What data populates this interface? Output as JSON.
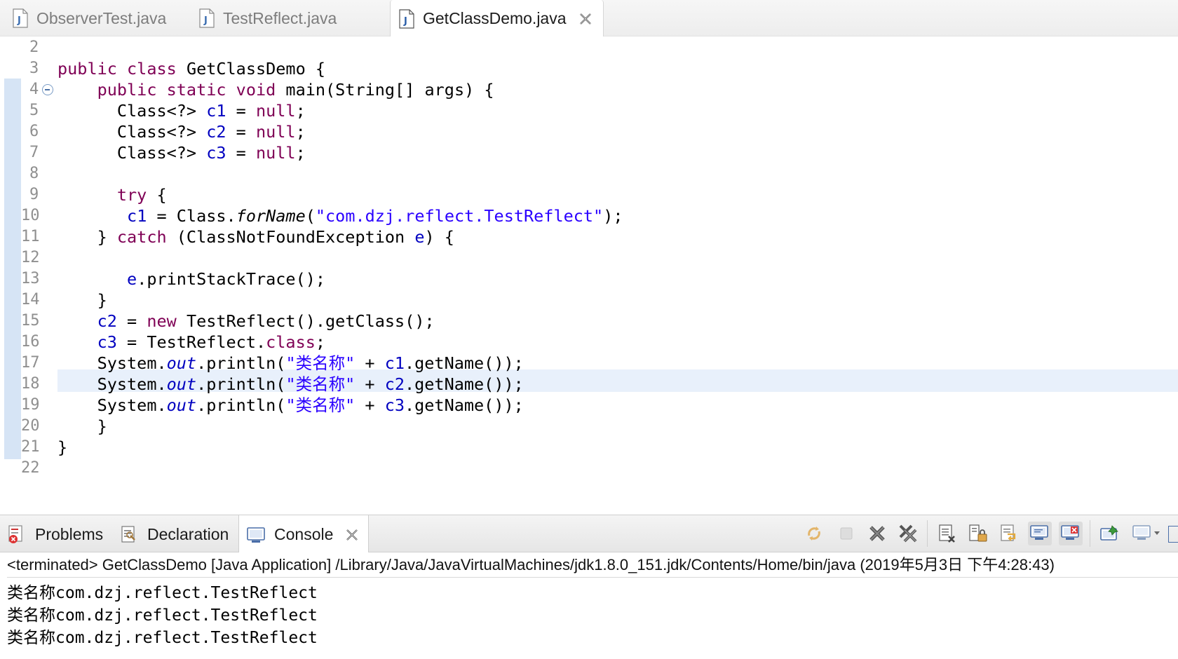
{
  "editor_tabs": [
    {
      "label": "ObserverTest.java",
      "active": false
    },
    {
      "label": "TestReflect.java",
      "active": false
    },
    {
      "label": "GetClassDemo.java",
      "active": true
    }
  ],
  "code_lines": [
    {
      "n": "2",
      "segs": []
    },
    {
      "n": "3",
      "segs": [
        [
          "kw",
          "public class "
        ],
        [
          "",
          "GetClassDemo {"
        ]
      ]
    },
    {
      "n": "4",
      "fold": true,
      "segs": [
        [
          "",
          "    "
        ],
        [
          "kw",
          "public static void "
        ],
        [
          "",
          "main(String[] args) {"
        ]
      ]
    },
    {
      "n": "5",
      "segs": [
        [
          "",
          "      Class<?> "
        ],
        [
          "fld",
          "c1"
        ],
        [
          "",
          " = "
        ],
        [
          "kw",
          "null"
        ],
        [
          "",
          ";"
        ]
      ]
    },
    {
      "n": "6",
      "segs": [
        [
          "",
          "      Class<?> "
        ],
        [
          "fld",
          "c2"
        ],
        [
          "",
          " = "
        ],
        [
          "kw",
          "null"
        ],
        [
          "",
          ";"
        ]
      ]
    },
    {
      "n": "7",
      "segs": [
        [
          "",
          "      Class<?> "
        ],
        [
          "fld",
          "c3"
        ],
        [
          "",
          " = "
        ],
        [
          "kw",
          "null"
        ],
        [
          "",
          ";"
        ]
      ]
    },
    {
      "n": "8",
      "segs": []
    },
    {
      "n": "9",
      "segs": [
        [
          "",
          "      "
        ],
        [
          "kw",
          "try"
        ],
        [
          "",
          " {"
        ]
      ]
    },
    {
      "n": "10",
      "segs": [
        [
          "",
          "       "
        ],
        [
          "fld",
          "c1"
        ],
        [
          "",
          " = Class."
        ],
        [
          "it",
          "forName"
        ],
        [
          "",
          "("
        ],
        [
          "str",
          "\"com.dzj.reflect.TestReflect\""
        ],
        [
          "",
          ");"
        ]
      ]
    },
    {
      "n": "11",
      "segs": [
        [
          "",
          "    } "
        ],
        [
          "kw",
          "catch"
        ],
        [
          "",
          " (ClassNotFoundException "
        ],
        [
          "fld",
          "e"
        ],
        [
          "",
          ") {"
        ]
      ]
    },
    {
      "n": "12",
      "segs": []
    },
    {
      "n": "13",
      "segs": [
        [
          "",
          "       "
        ],
        [
          "fld",
          "e"
        ],
        [
          "",
          ".printStackTrace();"
        ]
      ]
    },
    {
      "n": "14",
      "segs": [
        [
          "",
          "    }"
        ]
      ]
    },
    {
      "n": "15",
      "segs": [
        [
          "",
          "    "
        ],
        [
          "fld",
          "c2"
        ],
        [
          "",
          " = "
        ],
        [
          "kw",
          "new"
        ],
        [
          "",
          " TestReflect().getClass();"
        ]
      ]
    },
    {
      "n": "16",
      "segs": [
        [
          "",
          "    "
        ],
        [
          "fld",
          "c3"
        ],
        [
          "",
          " = TestReflect."
        ],
        [
          "kw",
          "class"
        ],
        [
          "",
          ";"
        ]
      ]
    },
    {
      "n": "17",
      "current": true,
      "segs": [
        [
          "",
          "    System."
        ],
        [
          "fld it",
          "out"
        ],
        [
          "",
          ".println("
        ],
        [
          "str",
          "\"类名称\""
        ],
        [
          "",
          " + "
        ],
        [
          "fld",
          "c1"
        ],
        [
          "",
          ".getName());"
        ]
      ]
    },
    {
      "n": "18",
      "segs": [
        [
          "",
          "    System."
        ],
        [
          "fld it",
          "out"
        ],
        [
          "",
          ".println("
        ],
        [
          "str",
          "\"类名称\""
        ],
        [
          "",
          " + "
        ],
        [
          "fld",
          "c2"
        ],
        [
          "",
          ".getName());"
        ]
      ]
    },
    {
      "n": "19",
      "segs": [
        [
          "",
          "    System."
        ],
        [
          "fld it",
          "out"
        ],
        [
          "",
          ".println("
        ],
        [
          "str",
          "\"类名称\""
        ],
        [
          "",
          " + "
        ],
        [
          "fld",
          "c3"
        ],
        [
          "",
          ".getName());"
        ]
      ]
    },
    {
      "n": "20",
      "segs": [
        [
          "",
          "    }"
        ]
      ]
    },
    {
      "n": "21",
      "segs": [
        [
          "",
          "}"
        ]
      ]
    },
    {
      "n": "22",
      "segs": []
    }
  ],
  "panel_tabs": [
    {
      "label": "Problems",
      "icon": "problems-icon"
    },
    {
      "label": "Declaration",
      "icon": "declaration-icon"
    },
    {
      "label": "Console",
      "icon": "console-icon",
      "active": true
    }
  ],
  "console": {
    "header": "<terminated> GetClassDemo [Java Application] /Library/Java/JavaVirtualMachines/jdk1.8.0_151.jdk/Contents/Home/bin/java (2019年5月3日 下午4:28:43)",
    "output": [
      "类名称com.dzj.reflect.TestReflect",
      "类名称com.dzj.reflect.TestReflect",
      "类名称com.dzj.reflect.TestReflect"
    ]
  },
  "toolbar_icons": [
    "sync-icon",
    "stop-icon",
    "remove-launch-icon",
    "remove-all-launches-icon",
    "clear-console-icon",
    "scroll-lock-icon",
    "word-wrap-icon",
    "show-on-stdout-icon",
    "show-on-stderr-icon",
    "pin-console-icon",
    "open-console-icon"
  ],
  "colors": {
    "keyword": "#7f0055",
    "field": "#0000c0",
    "string": "#2a00ff",
    "current_line": "#e8f0fb"
  }
}
